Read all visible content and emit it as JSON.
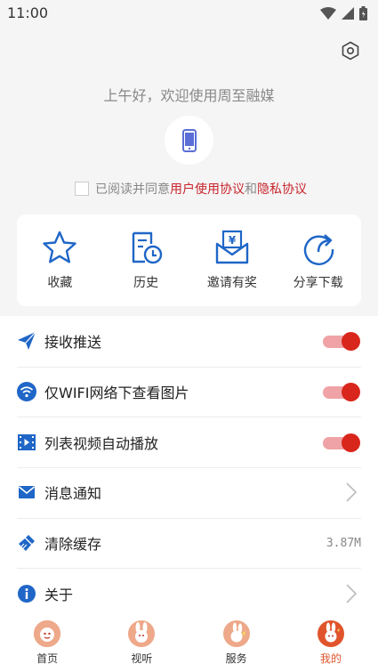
{
  "status_bar": {
    "time": "11:00"
  },
  "profile": {
    "greeting": "上午好，欢迎使用周至融媒",
    "agreement": {
      "prefix": "已阅读并同意",
      "user_agreement": "用户使用协议",
      "joiner": "和",
      "privacy_agreement": "隐私协议"
    }
  },
  "quick_actions": [
    {
      "label": "收藏",
      "icon": "star-icon"
    },
    {
      "label": "历史",
      "icon": "history-icon"
    },
    {
      "label": "邀请有奖",
      "icon": "invite-reward-icon"
    },
    {
      "label": "分享下载",
      "icon": "share-download-icon"
    }
  ],
  "settings": [
    {
      "label": "接收推送",
      "icon": "paper-plane-icon",
      "control": "toggle",
      "on": true
    },
    {
      "label": "仅WIFI网络下查看图片",
      "icon": "wifi-icon",
      "control": "toggle",
      "on": true
    },
    {
      "label": "列表视频自动播放",
      "icon": "video-icon",
      "control": "toggle",
      "on": true
    },
    {
      "label": "消息通知",
      "icon": "envelope-icon",
      "control": "chevron"
    },
    {
      "label": "清除缓存",
      "icon": "broom-icon",
      "control": "value",
      "value": "3.87M"
    },
    {
      "label": "关于",
      "icon": "info-icon",
      "control": "chevron"
    }
  ],
  "bottom_nav": [
    {
      "label": "首页",
      "icon": "home-mascot-icon",
      "active": false
    },
    {
      "label": "视听",
      "icon": "media-mascot-icon",
      "active": false
    },
    {
      "label": "服务",
      "icon": "service-mascot-icon",
      "active": false
    },
    {
      "label": "我的",
      "icon": "me-mascot-icon",
      "active": true
    }
  ],
  "colors": {
    "accent": "#c8252c",
    "icon_blue": "#1f66c7",
    "toggle_on": "#d9261c"
  }
}
